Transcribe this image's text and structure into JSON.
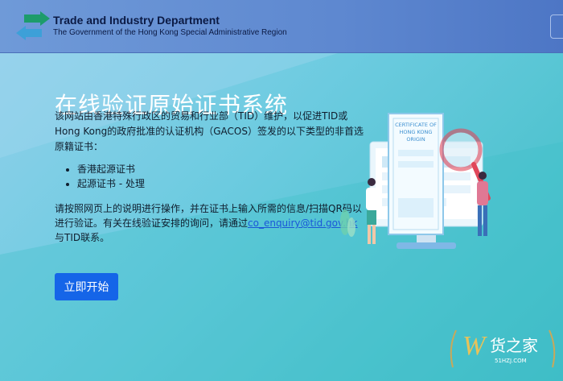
{
  "header": {
    "department": "Trade and Industry Department",
    "government": "The Government of the Hong Kong Special Administrative Region"
  },
  "main": {
    "title": "在线验证原始证书系统",
    "intro": "该网站由香港特殊行政区的贸易和行业部（TID）维护，以促进TID或Hong Kong的政府批准的认证机构（GACOS）签发的以下类型的非首选原籍证书：",
    "cert_types": [
      "香港起源证书",
      "起源证书 - 处理"
    ],
    "instructions_before": "请按照网页上的说明进行操作，并在证书上输入所需的信息/扫描QR码以进行验证。有关在线验证安排的询问，请通过",
    "email": "co_enquiry@tid.gov.hk",
    "instructions_after": "与TID联系。",
    "start_button": "立即开始"
  },
  "illustration": {
    "certificate_text": [
      "CERTIFICATE OF",
      "HONG KONG",
      "ORIGIN"
    ]
  },
  "watermark": {
    "brand": "货之家",
    "site": "51HZJ.COM"
  },
  "colors": {
    "header": "#5e88d0",
    "accent_button": "#1565e8",
    "link": "#1a57d8",
    "magnifier": "#e0475a"
  }
}
